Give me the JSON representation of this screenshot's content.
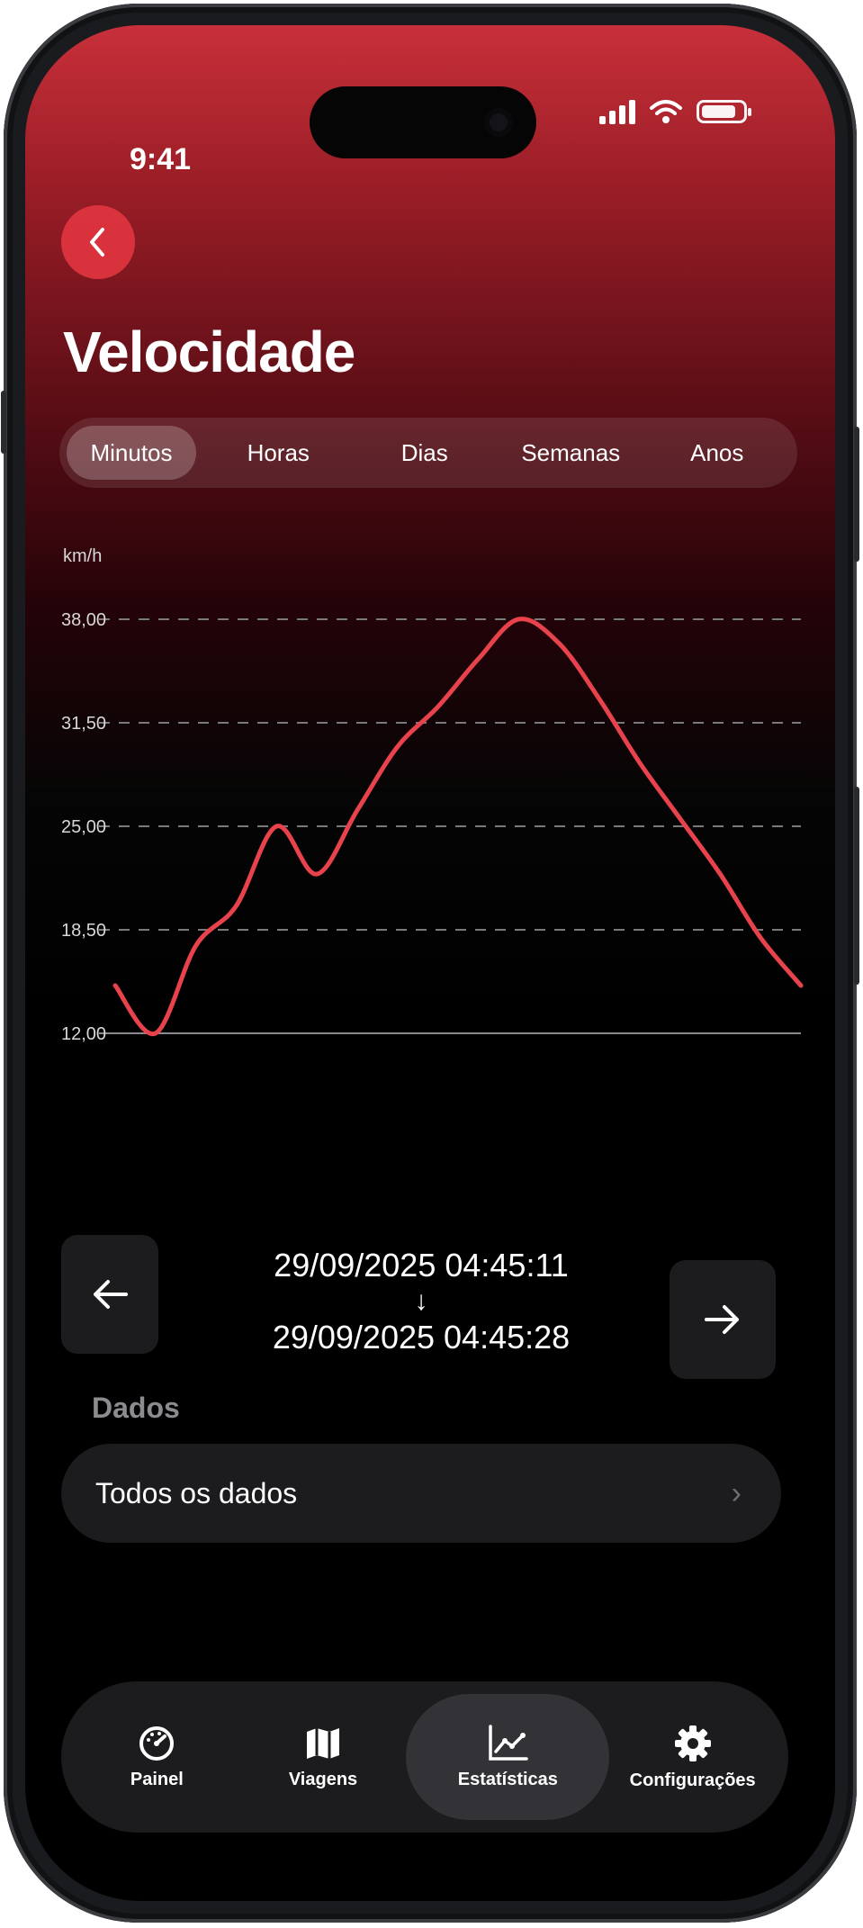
{
  "status": {
    "time": "9:41"
  },
  "header": {
    "title": "Velocidade",
    "back_icon": "chevron-left-icon"
  },
  "segments": {
    "items": [
      "Minutos",
      "Horas",
      "Dias",
      "Semanas",
      "Anos"
    ],
    "selected": "Minutos"
  },
  "chart_data": {
    "type": "line",
    "ylabel": "km/h",
    "ylim": [
      12,
      38
    ],
    "yticks": [
      "38,00",
      "31,50",
      "25,00",
      "18,50",
      "12,00"
    ],
    "grid": "dashed horizontal",
    "color": "#e8424c",
    "series": [
      {
        "values": [
          15.0,
          12.0,
          17.5,
          20.0,
          25.0,
          22.0,
          26.0,
          30.0,
          32.5,
          35.5,
          38.0,
          36.5,
          33.0,
          29.0,
          25.5,
          22.0,
          18.0,
          15.0
        ]
      }
    ]
  },
  "range": {
    "start": "29/09/2025 04:45:11",
    "arrow": "↓",
    "end": "29/09/2025 04:45:28"
  },
  "data_section": {
    "title": "Dados",
    "row_label": "Todos os dados",
    "row_chevron": "›"
  },
  "tabbar": {
    "items": [
      {
        "label": "Painel",
        "icon": "speedometer-icon"
      },
      {
        "label": "Viagens",
        "icon": "map-icon"
      },
      {
        "label": "Estatísticas",
        "icon": "line-chart-icon"
      },
      {
        "label": "Configurações",
        "icon": "gear-icon"
      }
    ],
    "selected": "Estatísticas"
  }
}
